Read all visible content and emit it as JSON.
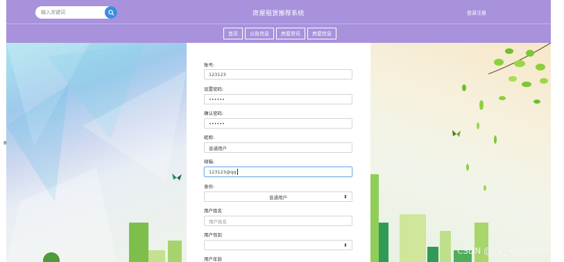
{
  "header": {
    "search_placeholder": "输入关键词",
    "site_title": "房屋租赁推荐系统",
    "login_link": "登录注册"
  },
  "nav": {
    "items": [
      {
        "label": "首页"
      },
      {
        "label": "公告信息"
      },
      {
        "label": "房屋资讯"
      },
      {
        "label": "房屋信息"
      }
    ]
  },
  "form": {
    "account_label": "账号:",
    "account_value": "123123",
    "password_label": "设置密码:",
    "password_value": "••••••",
    "confirm_label": "确认密码:",
    "confirm_value": "••••••",
    "nickname_label": "昵称:",
    "nickname_value": "普通用户",
    "email_label": "邮箱:",
    "email_value": "123123@qq",
    "role_label": "身份:",
    "role_value": "普通用户",
    "realname_label": "用户姓名",
    "realname_placeholder": "用户姓名",
    "gender_label": "用户性别",
    "gender_value": "",
    "age_label": "用户年龄"
  },
  "watermark": "CSDN @vx__bysj6869",
  "colors": {
    "header_bg": "#a892dc",
    "search_button": "#3b8de0"
  }
}
